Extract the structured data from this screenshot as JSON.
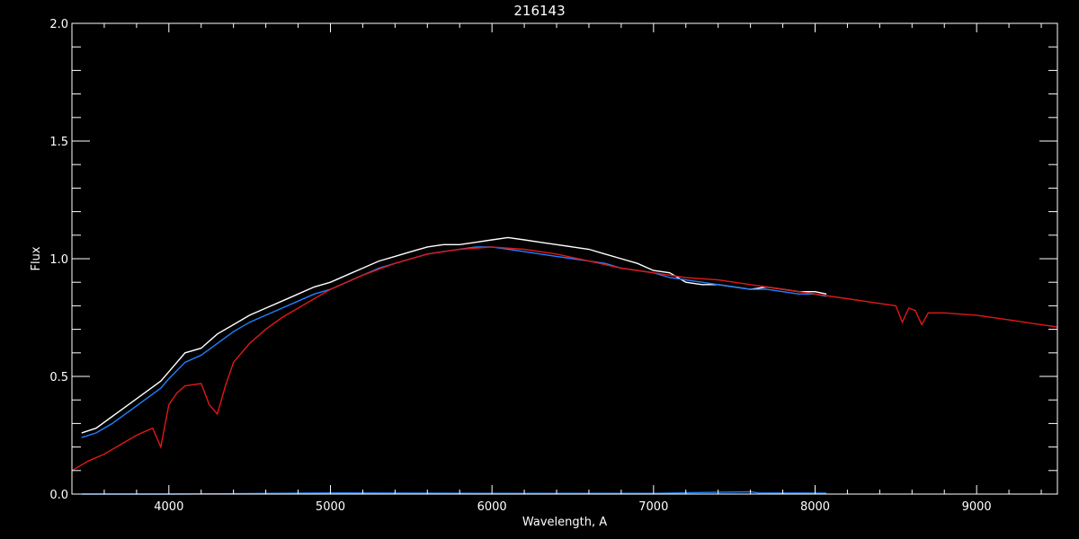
{
  "chart_data": {
    "type": "line",
    "title": "216143",
    "xlabel": "Wavelength, A",
    "ylabel": "Flux",
    "xlim": [
      3400,
      9500
    ],
    "ylim": [
      0.0,
      2.0
    ],
    "x_ticks": [
      4000,
      5000,
      6000,
      7000,
      8000,
      9000
    ],
    "y_ticks": [
      0.0,
      0.5,
      1.0,
      1.5,
      2.0
    ],
    "y_tick_labels": [
      "0.0",
      "0.5",
      "1.0",
      "1.5",
      "2.0"
    ],
    "grid": false,
    "colors": {
      "background": "#000000",
      "axes": "#ffffff",
      "observed": "#ffffff",
      "model": "#1e82ff",
      "reference": "#e01818"
    },
    "series": [
      {
        "color": "#ffffff",
        "x": [
          3460,
          3550,
          3650,
          3750,
          3850,
          3950,
          4000,
          4100,
          4200,
          4300,
          4400,
          4500,
          4600,
          4700,
          4800,
          4900,
          5000,
          5100,
          5200,
          5300,
          5400,
          5500,
          5600,
          5700,
          5800,
          5900,
          6000,
          6100,
          6200,
          6300,
          6400,
          6500,
          6600,
          6700,
          6800,
          6900,
          7000,
          7100,
          7200,
          7300,
          7400,
          7500,
          7600,
          7700,
          7800,
          7900,
          8000,
          8070
        ],
        "y": [
          0.26,
          0.28,
          0.33,
          0.38,
          0.43,
          0.48,
          0.52,
          0.6,
          0.62,
          0.68,
          0.72,
          0.76,
          0.79,
          0.82,
          0.85,
          0.88,
          0.9,
          0.93,
          0.96,
          0.99,
          1.01,
          1.03,
          1.05,
          1.06,
          1.06,
          1.07,
          1.08,
          1.09,
          1.08,
          1.07,
          1.06,
          1.05,
          1.04,
          1.02,
          1.0,
          0.98,
          0.95,
          0.94,
          0.9,
          0.89,
          0.89,
          0.88,
          0.87,
          0.88,
          0.87,
          0.86,
          0.86,
          0.85
        ]
      },
      {
        "color": "#1e82ff",
        "x": [
          3460,
          3550,
          3650,
          3750,
          3850,
          3950,
          4000,
          4100,
          4200,
          4300,
          4400,
          4500,
          4600,
          4700,
          4800,
          4900,
          5000,
          5100,
          5200,
          5300,
          5400,
          5500,
          5600,
          5700,
          5800,
          5900,
          6000,
          6100,
          6200,
          6300,
          6400,
          6500,
          6600,
          6700,
          6800,
          6900,
          7000,
          7100,
          7200,
          7300,
          7400,
          7500,
          7600,
          7700,
          7800,
          7900,
          8000,
          8070
        ],
        "y": [
          0.24,
          0.26,
          0.3,
          0.35,
          0.4,
          0.45,
          0.49,
          0.56,
          0.59,
          0.64,
          0.69,
          0.73,
          0.76,
          0.79,
          0.82,
          0.85,
          0.87,
          0.9,
          0.93,
          0.96,
          0.98,
          1.0,
          1.02,
          1.03,
          1.04,
          1.05,
          1.05,
          1.04,
          1.03,
          1.02,
          1.01,
          1.0,
          0.99,
          0.98,
          0.96,
          0.95,
          0.94,
          0.92,
          0.91,
          0.9,
          0.89,
          0.88,
          0.87,
          0.87,
          0.86,
          0.85,
          0.85,
          0.84
        ]
      },
      {
        "color": "#e01818",
        "x": [
          3400,
          3500,
          3600,
          3700,
          3800,
          3900,
          3950,
          4000,
          4050,
          4100,
          4200,
          4250,
          4300,
          4350,
          4400,
          4500,
          4600,
          4700,
          4800,
          4900,
          5000,
          5200,
          5400,
          5600,
          5800,
          6000,
          6200,
          6400,
          6600,
          6800,
          7000,
          7200,
          7400,
          7600,
          7800,
          8000,
          8200,
          8400,
          8500,
          8540,
          8580,
          8620,
          8660,
          8700,
          8800,
          9000,
          9200,
          9400,
          9500
        ],
        "y": [
          0.1,
          0.14,
          0.17,
          0.21,
          0.25,
          0.28,
          0.2,
          0.38,
          0.43,
          0.46,
          0.47,
          0.38,
          0.34,
          0.46,
          0.56,
          0.64,
          0.7,
          0.75,
          0.79,
          0.83,
          0.87,
          0.93,
          0.98,
          1.02,
          1.04,
          1.05,
          1.04,
          1.02,
          0.99,
          0.96,
          0.94,
          0.92,
          0.91,
          0.89,
          0.87,
          0.85,
          0.83,
          0.81,
          0.8,
          0.73,
          0.79,
          0.78,
          0.72,
          0.77,
          0.77,
          0.76,
          0.74,
          0.72,
          0.71
        ]
      },
      {
        "color": "#1e82ff",
        "x": [
          3460,
          4000,
          5000,
          6000,
          7000,
          7600,
          7650,
          8070
        ],
        "y": [
          0.0,
          0.0,
          0.005,
          0.003,
          0.003,
          0.01,
          0.005,
          0.004
        ]
      }
    ]
  }
}
